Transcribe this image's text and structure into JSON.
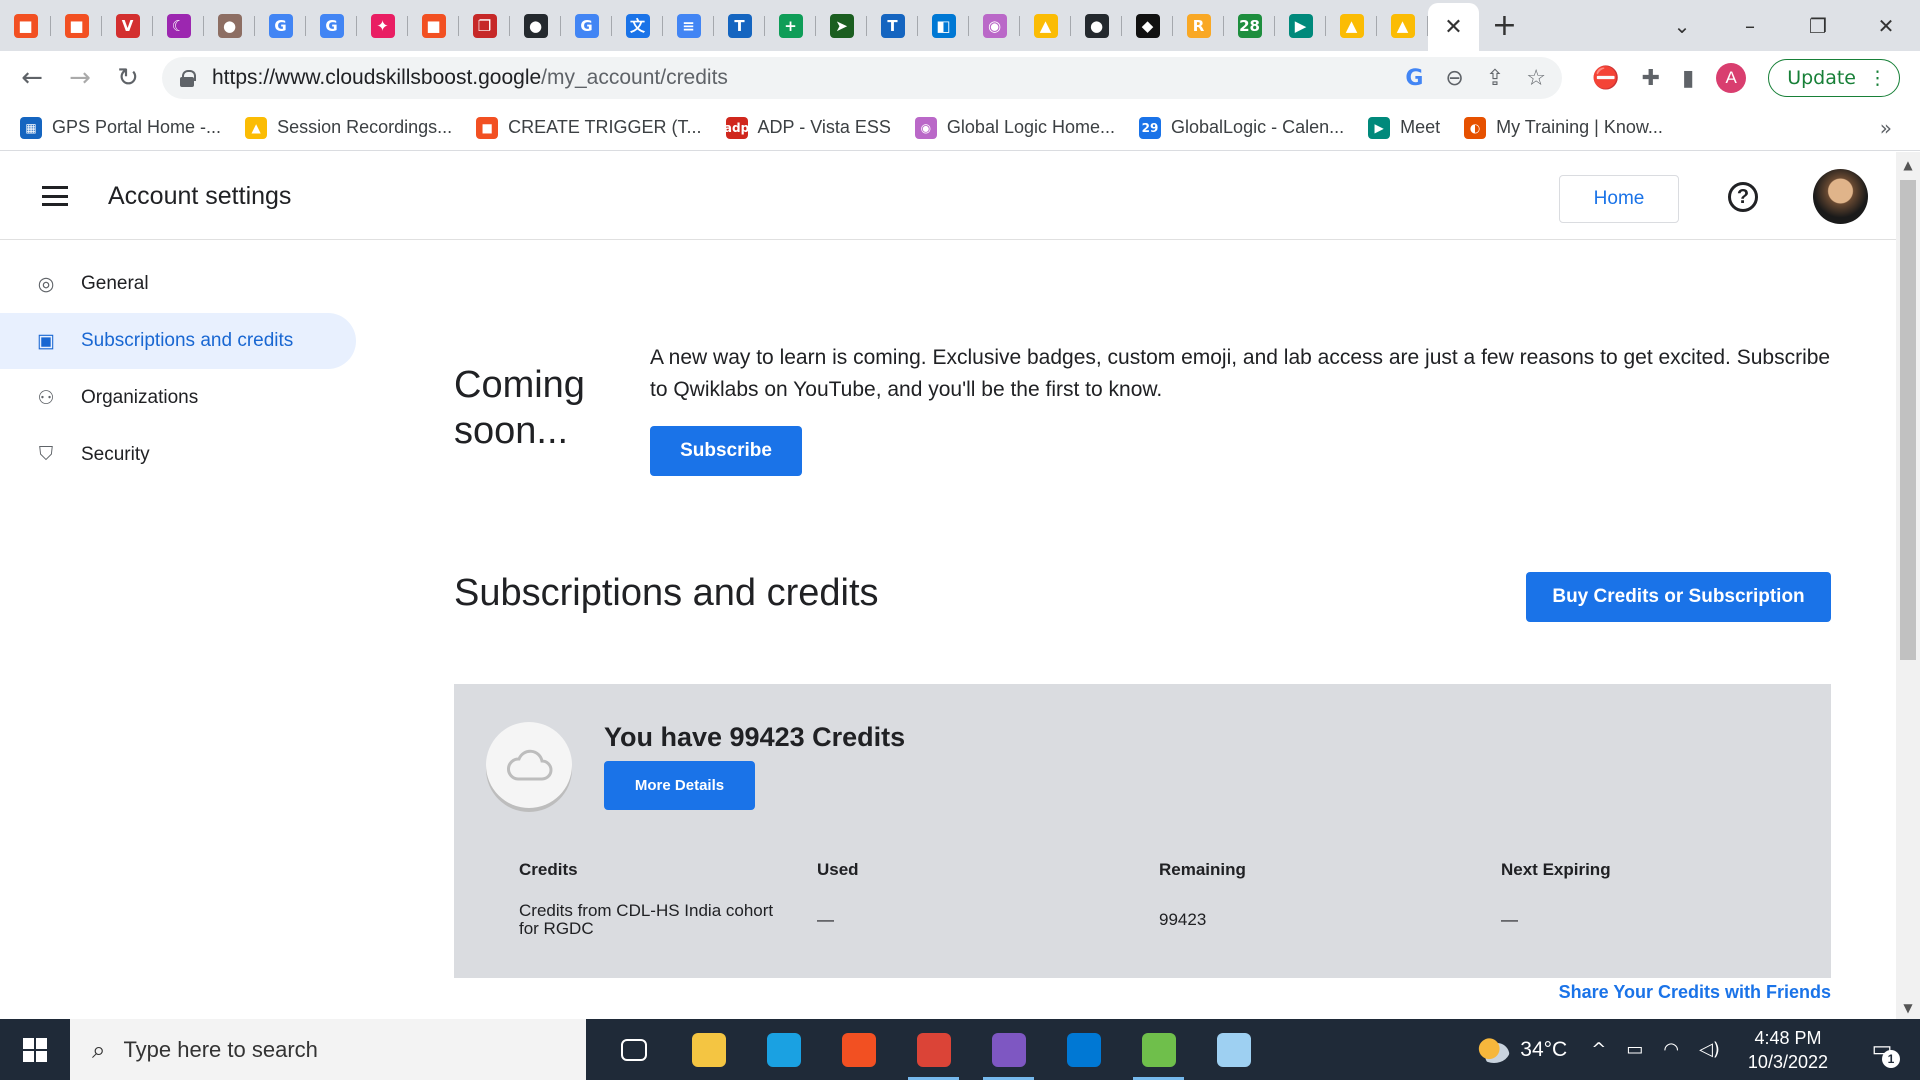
{
  "browser": {
    "tabs": [
      {
        "icon": "microsoft-icon",
        "color": "#f25022",
        "glyph": "■"
      },
      {
        "icon": "microsoft-icon",
        "color": "#f25022",
        "glyph": "■"
      },
      {
        "icon": "vivaldi-v-icon",
        "color": "#d32f2f",
        "glyph": "V"
      },
      {
        "icon": "moon-icon",
        "color": "#9c27b0",
        "glyph": "☾"
      },
      {
        "icon": "profile-photo-icon",
        "color": "#8d6e63",
        "glyph": "●"
      },
      {
        "icon": "google-icon",
        "color": "#4285f4",
        "glyph": "G"
      },
      {
        "icon": "google-icon",
        "color": "#4285f4",
        "glyph": "G"
      },
      {
        "icon": "slack-like-icon",
        "color": "#e91e63",
        "glyph": "✦"
      },
      {
        "icon": "microsoft-icon",
        "color": "#f25022",
        "glyph": "■"
      },
      {
        "icon": "clipboard-icon",
        "color": "#c62828",
        "glyph": "❐"
      },
      {
        "icon": "github-icon",
        "color": "#24292e",
        "glyph": "●"
      },
      {
        "icon": "google-icon",
        "color": "#4285f4",
        "glyph": "G"
      },
      {
        "icon": "translate-icon",
        "color": "#1a73e8",
        "glyph": "文"
      },
      {
        "icon": "docs-icon",
        "color": "#4285f4",
        "glyph": "≡"
      },
      {
        "icon": "t-icon",
        "color": "#1565c0",
        "glyph": "T"
      },
      {
        "icon": "plus-square-icon",
        "color": "#0f9d58",
        "glyph": "+"
      },
      {
        "icon": "arrow-icon",
        "color": "#1b5e20",
        "glyph": "➤"
      },
      {
        "icon": "t-icon",
        "color": "#1565c0",
        "glyph": "T"
      },
      {
        "icon": "azure-devops-icon",
        "color": "#0078d4",
        "glyph": "◧"
      },
      {
        "icon": "pink-circle-icon",
        "color": "#ba68c8",
        "glyph": "◉"
      },
      {
        "icon": "google-drive-icon",
        "color": "#fbbc04",
        "glyph": "▲"
      },
      {
        "icon": "github-icon",
        "color": "#24292e",
        "glyph": "●"
      },
      {
        "icon": "unity-icon",
        "color": "#111111",
        "glyph": "◆"
      },
      {
        "icon": "badge-r-icon",
        "color": "#f9a825",
        "glyph": "R"
      },
      {
        "icon": "badge-28-icon",
        "color": "#1e8e3e",
        "glyph": "28"
      },
      {
        "icon": "google-meet-icon",
        "color": "#00897b",
        "glyph": "▶"
      },
      {
        "icon": "google-drive-icon",
        "color": "#fbbc04",
        "glyph": "▲"
      },
      {
        "icon": "google-drive-icon",
        "color": "#fbbc04",
        "glyph": "▲"
      }
    ],
    "active_tab_close": "✕",
    "new_tab": "+",
    "url_host": "https://www.cloudskillsboost.google",
    "url_path": "/my_account/credits",
    "update_label": "Update",
    "profile_initial": "A",
    "bookmarks": [
      {
        "label": "GPS Portal Home -...",
        "icon": "gps-portal-icon",
        "color": "#1565c0",
        "glyph": "▦"
      },
      {
        "label": "Session Recordings...",
        "icon": "google-drive-icon",
        "color": "#fbbc04",
        "glyph": "▲"
      },
      {
        "label": "CREATE TRIGGER (T...",
        "icon": "microsoft-icon",
        "color": "#f25022",
        "glyph": "■"
      },
      {
        "label": "ADP - Vista ESS",
        "icon": "adp-icon",
        "color": "#d0271d",
        "glyph": "adp"
      },
      {
        "label": "Global Logic Home...",
        "icon": "globallogic-icon",
        "color": "#ba68c8",
        "glyph": "◉"
      },
      {
        "label": "GlobalLogic - Calen...",
        "icon": "calendar-29-icon",
        "color": "#1a73e8",
        "glyph": "29"
      },
      {
        "label": "Meet",
        "icon": "google-meet-icon",
        "color": "#00897b",
        "glyph": "▶"
      },
      {
        "label": "My Training | Know...",
        "icon": "training-icon",
        "color": "#e65100",
        "glyph": "◐"
      }
    ]
  },
  "app": {
    "title": "Account settings",
    "home_label": "Home",
    "help_glyph": "?",
    "sidebar": [
      {
        "label": "General",
        "icon": "account-circle-icon",
        "glyph": "◎",
        "active": false
      },
      {
        "label": "Subscriptions and credits",
        "icon": "credit-card-icon",
        "glyph": "▣",
        "active": true
      },
      {
        "label": "Organizations",
        "icon": "people-icon",
        "glyph": "⚇",
        "active": false
      },
      {
        "label": "Security",
        "icon": "shield-icon",
        "glyph": "⛉",
        "active": false
      }
    ],
    "coming_soon": {
      "title": "Coming soon...",
      "text": "A new way to learn is coming. Exclusive badges, custom emoji, and lab access are just a few reasons to get excited. Subscribe to Qwiklabs on YouTube, and you'll be the first to know.",
      "subscribe_label": "Subscribe"
    },
    "section_title": "Subscriptions and credits",
    "buy_label": "Buy Credits or Subscription",
    "credits": {
      "heading": "You have 99423 Credits",
      "more_label": "More Details",
      "columns": [
        "Credits",
        "Used",
        "Remaining",
        "Next Expiring"
      ],
      "rows": [
        [
          "Credits from CDL-HS India cohort for RGDC",
          "—",
          "99423",
          "—"
        ]
      ]
    },
    "share_label": "Share Your Credits with Friends"
  },
  "taskbar": {
    "search_placeholder": "Type here to search",
    "apps": [
      {
        "icon": "task-view-icon",
        "color": "#1f2a38",
        "open": false
      },
      {
        "icon": "file-explorer-icon",
        "color": "#f4c542",
        "open": false
      },
      {
        "icon": "edge-icon",
        "color": "#1aa1e2",
        "open": false
      },
      {
        "icon": "microsoft-store-icon",
        "color": "#f25022",
        "open": false
      },
      {
        "icon": "chrome-icon",
        "color": "#db4437",
        "open": true
      },
      {
        "icon": "visual-studio-icon",
        "color": "#7e57c2",
        "open": true
      },
      {
        "icon": "vscode-icon",
        "color": "#0078d4",
        "open": false
      },
      {
        "icon": "excel-app-icon",
        "color": "#6fbf4b",
        "open": true
      },
      {
        "icon": "notepad-icon",
        "color": "#9ed0f2",
        "open": false
      }
    ],
    "temperature": "34°C",
    "time": "4:48 PM",
    "date": "10/3/2022",
    "notification_count": "1"
  }
}
